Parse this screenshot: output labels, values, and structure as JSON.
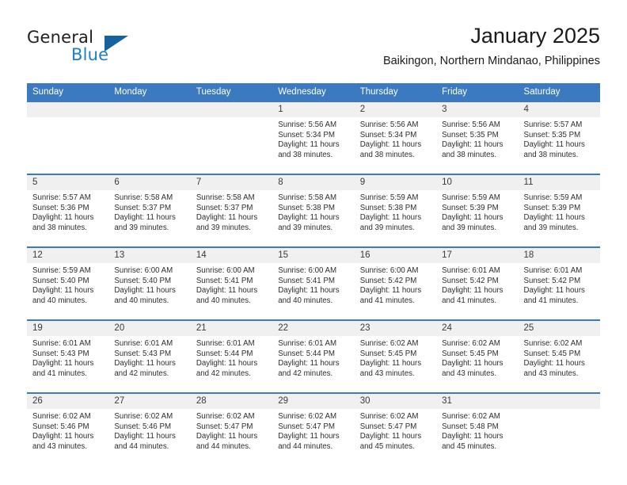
{
  "brand": {
    "name_part1": "General",
    "name_part2": "Blue",
    "triangle_icon": "brand-triangle-icon"
  },
  "header": {
    "title": "January 2025",
    "subtitle": "Baikingon, Northern Mindanao, Philippines"
  },
  "colors": {
    "header_blue": "#3b7ac0",
    "brand_blue": "#1f7fc4",
    "daynum_band": "#f0f0f0",
    "text": "#2d2d2d"
  },
  "weekdays": [
    "Sunday",
    "Monday",
    "Tuesday",
    "Wednesday",
    "Thursday",
    "Friday",
    "Saturday"
  ],
  "labels": {
    "sunrise_prefix": "Sunrise: ",
    "sunset_prefix": "Sunset: ",
    "daylight_prefix": "Daylight: "
  },
  "weeks": [
    [
      {
        "day": "",
        "sunrise": "",
        "sunset": "",
        "daylight": "",
        "empty": true
      },
      {
        "day": "",
        "sunrise": "",
        "sunset": "",
        "daylight": "",
        "empty": true
      },
      {
        "day": "",
        "sunrise": "",
        "sunset": "",
        "daylight": "",
        "empty": true
      },
      {
        "day": "1",
        "sunrise": "Sunrise: 5:56 AM",
        "sunset": "Sunset: 5:34 PM",
        "daylight": "Daylight: 11 hours and 38 minutes."
      },
      {
        "day": "2",
        "sunrise": "Sunrise: 5:56 AM",
        "sunset": "Sunset: 5:34 PM",
        "daylight": "Daylight: 11 hours and 38 minutes."
      },
      {
        "day": "3",
        "sunrise": "Sunrise: 5:56 AM",
        "sunset": "Sunset: 5:35 PM",
        "daylight": "Daylight: 11 hours and 38 minutes."
      },
      {
        "day": "4",
        "sunrise": "Sunrise: 5:57 AM",
        "sunset": "Sunset: 5:35 PM",
        "daylight": "Daylight: 11 hours and 38 minutes."
      }
    ],
    [
      {
        "day": "5",
        "sunrise": "Sunrise: 5:57 AM",
        "sunset": "Sunset: 5:36 PM",
        "daylight": "Daylight: 11 hours and 38 minutes."
      },
      {
        "day": "6",
        "sunrise": "Sunrise: 5:58 AM",
        "sunset": "Sunset: 5:37 PM",
        "daylight": "Daylight: 11 hours and 39 minutes."
      },
      {
        "day": "7",
        "sunrise": "Sunrise: 5:58 AM",
        "sunset": "Sunset: 5:37 PM",
        "daylight": "Daylight: 11 hours and 39 minutes."
      },
      {
        "day": "8",
        "sunrise": "Sunrise: 5:58 AM",
        "sunset": "Sunset: 5:38 PM",
        "daylight": "Daylight: 11 hours and 39 minutes."
      },
      {
        "day": "9",
        "sunrise": "Sunrise: 5:59 AM",
        "sunset": "Sunset: 5:38 PM",
        "daylight": "Daylight: 11 hours and 39 minutes."
      },
      {
        "day": "10",
        "sunrise": "Sunrise: 5:59 AM",
        "sunset": "Sunset: 5:39 PM",
        "daylight": "Daylight: 11 hours and 39 minutes."
      },
      {
        "day": "11",
        "sunrise": "Sunrise: 5:59 AM",
        "sunset": "Sunset: 5:39 PM",
        "daylight": "Daylight: 11 hours and 39 minutes."
      }
    ],
    [
      {
        "day": "12",
        "sunrise": "Sunrise: 5:59 AM",
        "sunset": "Sunset: 5:40 PM",
        "daylight": "Daylight: 11 hours and 40 minutes."
      },
      {
        "day": "13",
        "sunrise": "Sunrise: 6:00 AM",
        "sunset": "Sunset: 5:40 PM",
        "daylight": "Daylight: 11 hours and 40 minutes."
      },
      {
        "day": "14",
        "sunrise": "Sunrise: 6:00 AM",
        "sunset": "Sunset: 5:41 PM",
        "daylight": "Daylight: 11 hours and 40 minutes."
      },
      {
        "day": "15",
        "sunrise": "Sunrise: 6:00 AM",
        "sunset": "Sunset: 5:41 PM",
        "daylight": "Daylight: 11 hours and 40 minutes."
      },
      {
        "day": "16",
        "sunrise": "Sunrise: 6:00 AM",
        "sunset": "Sunset: 5:42 PM",
        "daylight": "Daylight: 11 hours and 41 minutes."
      },
      {
        "day": "17",
        "sunrise": "Sunrise: 6:01 AM",
        "sunset": "Sunset: 5:42 PM",
        "daylight": "Daylight: 11 hours and 41 minutes."
      },
      {
        "day": "18",
        "sunrise": "Sunrise: 6:01 AM",
        "sunset": "Sunset: 5:42 PM",
        "daylight": "Daylight: 11 hours and 41 minutes."
      }
    ],
    [
      {
        "day": "19",
        "sunrise": "Sunrise: 6:01 AM",
        "sunset": "Sunset: 5:43 PM",
        "daylight": "Daylight: 11 hours and 41 minutes."
      },
      {
        "day": "20",
        "sunrise": "Sunrise: 6:01 AM",
        "sunset": "Sunset: 5:43 PM",
        "daylight": "Daylight: 11 hours and 42 minutes."
      },
      {
        "day": "21",
        "sunrise": "Sunrise: 6:01 AM",
        "sunset": "Sunset: 5:44 PM",
        "daylight": "Daylight: 11 hours and 42 minutes."
      },
      {
        "day": "22",
        "sunrise": "Sunrise: 6:01 AM",
        "sunset": "Sunset: 5:44 PM",
        "daylight": "Daylight: 11 hours and 42 minutes."
      },
      {
        "day": "23",
        "sunrise": "Sunrise: 6:02 AM",
        "sunset": "Sunset: 5:45 PM",
        "daylight": "Daylight: 11 hours and 43 minutes."
      },
      {
        "day": "24",
        "sunrise": "Sunrise: 6:02 AM",
        "sunset": "Sunset: 5:45 PM",
        "daylight": "Daylight: 11 hours and 43 minutes."
      },
      {
        "day": "25",
        "sunrise": "Sunrise: 6:02 AM",
        "sunset": "Sunset: 5:45 PM",
        "daylight": "Daylight: 11 hours and 43 minutes."
      }
    ],
    [
      {
        "day": "26",
        "sunrise": "Sunrise: 6:02 AM",
        "sunset": "Sunset: 5:46 PM",
        "daylight": "Daylight: 11 hours and 43 minutes."
      },
      {
        "day": "27",
        "sunrise": "Sunrise: 6:02 AM",
        "sunset": "Sunset: 5:46 PM",
        "daylight": "Daylight: 11 hours and 44 minutes."
      },
      {
        "day": "28",
        "sunrise": "Sunrise: 6:02 AM",
        "sunset": "Sunset: 5:47 PM",
        "daylight": "Daylight: 11 hours and 44 minutes."
      },
      {
        "day": "29",
        "sunrise": "Sunrise: 6:02 AM",
        "sunset": "Sunset: 5:47 PM",
        "daylight": "Daylight: 11 hours and 44 minutes."
      },
      {
        "day": "30",
        "sunrise": "Sunrise: 6:02 AM",
        "sunset": "Sunset: 5:47 PM",
        "daylight": "Daylight: 11 hours and 45 minutes."
      },
      {
        "day": "31",
        "sunrise": "Sunrise: 6:02 AM",
        "sunset": "Sunset: 5:48 PM",
        "daylight": "Daylight: 11 hours and 45 minutes."
      },
      {
        "day": "",
        "sunrise": "",
        "sunset": "",
        "daylight": "",
        "empty": true
      }
    ]
  ]
}
